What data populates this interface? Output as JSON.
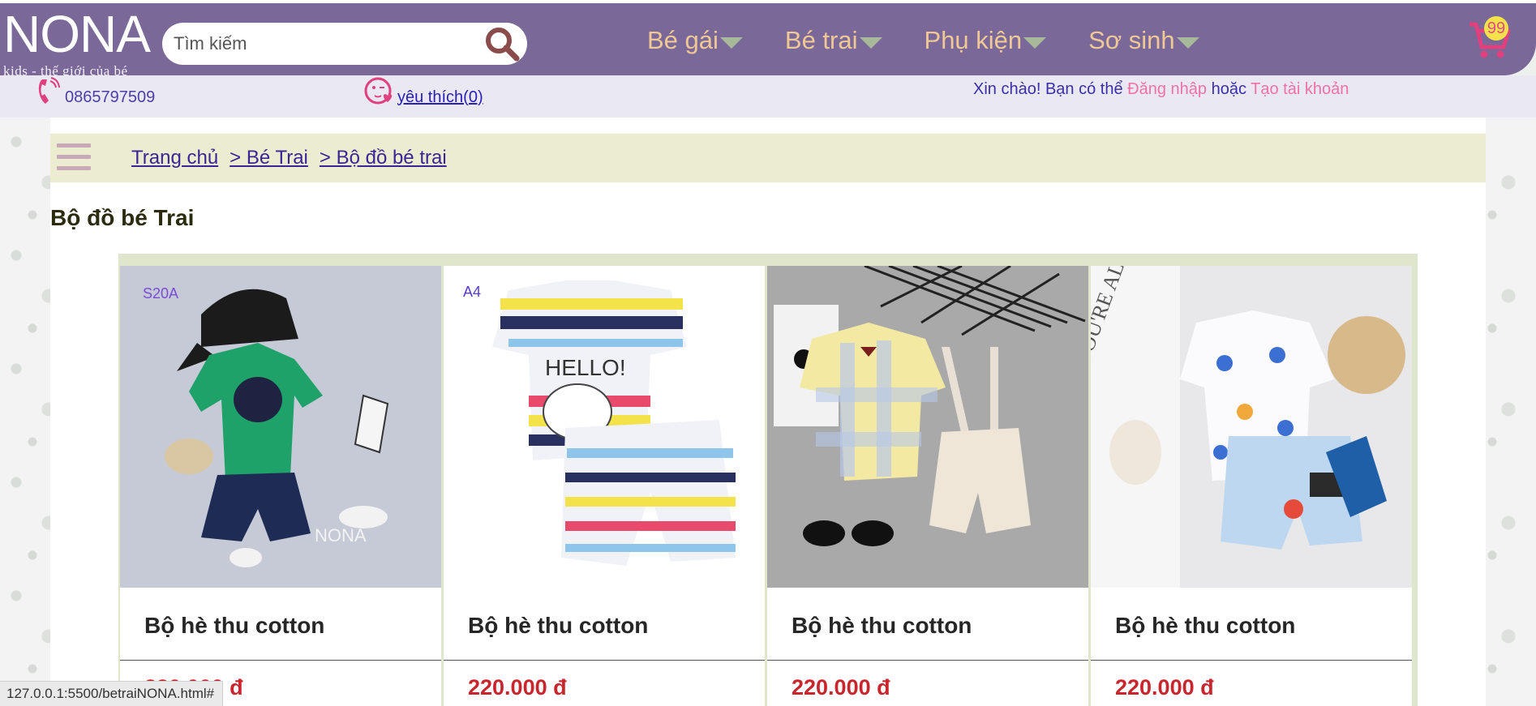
{
  "header": {
    "logo_main": "NONA",
    "logo_sub": "kids - thế giới của bé",
    "search_placeholder": "Tìm kiếm",
    "nav": [
      "Bé gái",
      "Bé trai",
      "Phụ kiện",
      "Sơ sinh"
    ],
    "cart_count": "99"
  },
  "subbar": {
    "phone": "0865797509",
    "favorites": "yêu thích(0)",
    "greet_prefix": "Xin chào! Bạn có thể ",
    "login": "Đăng nhập",
    "or": " hoặc ",
    "register": "Tạo tài khoản"
  },
  "breadcrumb": [
    "Trang chủ",
    "> Bé Trai",
    "> Bộ đồ bé trai"
  ],
  "page_title": "Bộ đồ bé Trai",
  "products": [
    {
      "code": "S20A",
      "name": "Bộ hè thu cotton",
      "price": "220.000 đ"
    },
    {
      "code": "A4",
      "name": "Bộ hè thu cotton",
      "price": "220.000 đ"
    },
    {
      "code": "",
      "name": "Bộ hè thu cotton",
      "price": "220.000 đ"
    },
    {
      "code": "",
      "name": "Bộ hè thu cotton",
      "price": "220.000 đ"
    }
  ],
  "status_url": "127.0.0.1:5500/betraiNONA.html#",
  "colors": {
    "header_bg": "#7a6898",
    "nav_text": "#efc896",
    "price": "#c8252c",
    "link_pink": "#f071a8"
  }
}
